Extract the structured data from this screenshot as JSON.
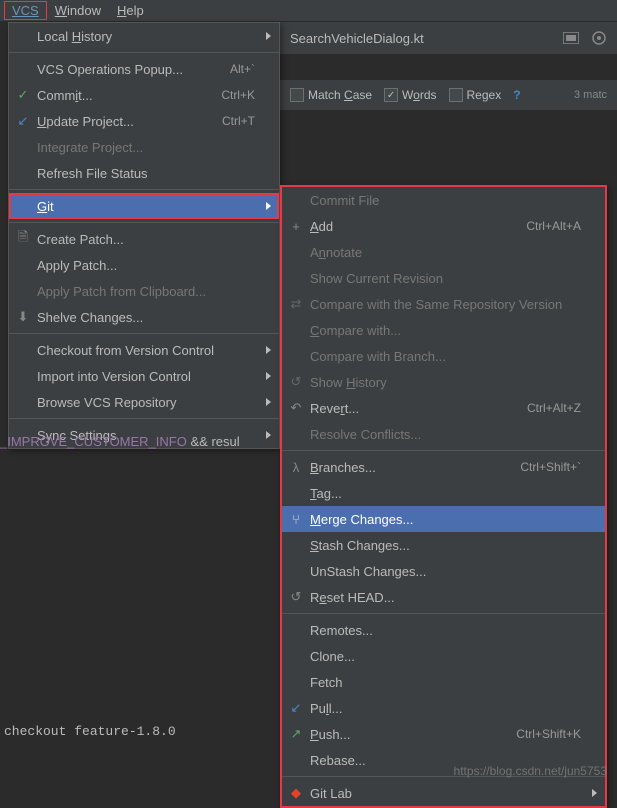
{
  "menubar": {
    "vcs": "VCS",
    "window": "Window",
    "help": "Help"
  },
  "tab": {
    "filename": "SearchVehicleDialog.kt"
  },
  "search_options": {
    "match_case": "Match Case",
    "words": "Words",
    "regex": "Regex",
    "match_count": "3 matc"
  },
  "menu1": {
    "local_history": "Local History",
    "vcs_operations": "VCS Operations Popup...",
    "vcs_operations_shortcut": "Alt+`",
    "commit": "Commit...",
    "commit_shortcut": "Ctrl+K",
    "update_project": "Update Project...",
    "update_project_shortcut": "Ctrl+T",
    "integrate_project": "Integrate Project...",
    "refresh_file_status": "Refresh File Status",
    "git": "Git",
    "create_patch": "Create Patch...",
    "apply_patch": "Apply Patch...",
    "apply_patch_clipboard": "Apply Patch from Clipboard...",
    "shelve_changes": "Shelve Changes...",
    "checkout_from_vc": "Checkout from Version Control",
    "import_into_vc": "Import into Version Control",
    "browse_vcs_repo": "Browse VCS Repository",
    "sync_settings": "Sync Settings"
  },
  "menu2": {
    "commit_file": "Commit File",
    "add": "Add",
    "add_shortcut": "Ctrl+Alt+A",
    "annotate": "Annotate",
    "show_current_revision": "Show Current Revision",
    "compare_same_repo": "Compare with the Same Repository Version",
    "compare_with": "Compare with...",
    "compare_with_branch": "Compare with Branch...",
    "show_history": "Show History",
    "revert": "Revert...",
    "revert_shortcut": "Ctrl+Alt+Z",
    "resolve_conflicts": "Resolve Conflicts...",
    "branches": "Branches...",
    "branches_shortcut": "Ctrl+Shift+`",
    "tag": "Tag...",
    "merge_changes": "Merge Changes...",
    "stash_changes": "Stash Changes...",
    "unstash_changes": "UnStash Changes...",
    "reset_head": "Reset HEAD...",
    "remotes": "Remotes...",
    "clone": "Clone...",
    "fetch": "Fetch",
    "pull": "Pull...",
    "push": "Push...",
    "push_shortcut": "Ctrl+Shift+K",
    "rebase": "Rebase...",
    "gitlab": "Git Lab"
  },
  "code": {
    "line1_part1": "_IMPROVE_CUSTOMER_INFO",
    "line1_amp": " && ",
    "line1_part2": "resul"
  },
  "terminal": {
    "line": "checkout feature-1.8.0"
  },
  "watermark": "https://blog.csdn.net/jun5753"
}
